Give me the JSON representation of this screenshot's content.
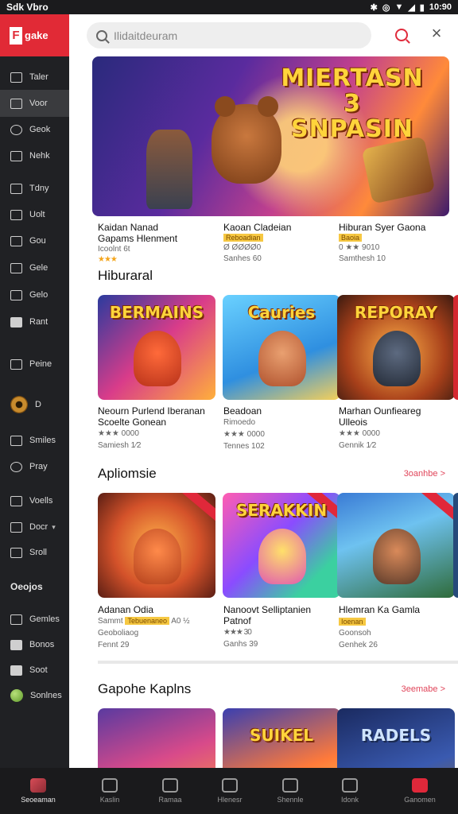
{
  "status_bar": {
    "left": "Sdk Vbro",
    "time": "10:90"
  },
  "sidebar": {
    "logo": "gake",
    "items": [
      {
        "label": "Taler",
        "icon": "tv-icon"
      },
      {
        "label": "Voor",
        "icon": "monitor-icon"
      },
      {
        "label": "Geok",
        "icon": "heart-icon"
      },
      {
        "label": "Nehk",
        "icon": "bookmark-icon"
      },
      {
        "label": "Tdny",
        "icon": "pen-icon"
      },
      {
        "label": "Uolt",
        "icon": "upload-icon"
      },
      {
        "label": "Gou",
        "icon": "home-icon"
      },
      {
        "label": "Gele",
        "icon": "grid-icon"
      },
      {
        "label": "Gelo",
        "icon": "folder-icon"
      },
      {
        "label": "Rant",
        "icon": "thumb-icon"
      },
      {
        "label": "Peine",
        "icon": "gallery-icon"
      },
      {
        "label": "D",
        "icon": "disc-icon"
      },
      {
        "label": "Smiles",
        "icon": "image-icon"
      },
      {
        "label": "Pray",
        "icon": "refresh-icon"
      },
      {
        "label": "Voells",
        "icon": "v-icon"
      },
      {
        "label": "Docr",
        "icon": "doc-icon"
      },
      {
        "label": "Sroll",
        "icon": "scroll-icon"
      },
      {
        "label": "Oeojos",
        "icon": ""
      },
      {
        "label": "Gemles",
        "icon": "share-icon"
      },
      {
        "label": "Bonos",
        "icon": "mail-icon"
      },
      {
        "label": "Soot",
        "icon": "check-icon"
      },
      {
        "label": "Sonlnes",
        "icon": "ball-icon"
      }
    ]
  },
  "search": {
    "placeholder": "Ilidaitdeuram"
  },
  "hero": {
    "title_line1": "MIERTASN 3",
    "title_line2": "SNPASIN",
    "games": [
      {
        "name": "Kaidan Nanad",
        "sub": "Gapams Hlenment",
        "meta": "Icoolnt 6t",
        "stars": "★★★"
      },
      {
        "name": "Kaoan Cladeian",
        "tag": "Reboadian",
        "meta": "Ø ØØØØ0",
        "sub2": "Sanhes 60"
      },
      {
        "name": "Hiburan Syer Gaona",
        "tag": "Baoia",
        "stars": "★★★",
        "meta": "0 ★★ 9010",
        "sub2": "Samthesh 10"
      }
    ]
  },
  "sections": [
    {
      "title": "Hiburaral",
      "cards": [
        {
          "title": "BERMAINS",
          "name": "Neourn Purlend Iberanan",
          "sub": "Scoelte Gonean",
          "meta": "★★★ 0000",
          "meta2": "Samiesh 1⁄2"
        },
        {
          "title": "Cauries",
          "name": "Beadoan",
          "sub": "Rimoedo",
          "meta": "★★★ 0000",
          "meta2": "Tennes 102"
        },
        {
          "title": "REPORAY",
          "name": "Marhan Ounfieareg",
          "sub": "Ulleois",
          "meta": "★★★ 0000",
          "meta2": "Gennik 1⁄2"
        }
      ]
    },
    {
      "title": "Apliomsie",
      "see_more": "3oanhbe >",
      "cards": [
        {
          "title": "",
          "name": "Adanan Odia",
          "sub": "Sammt",
          "tag": "Tebuenaneo",
          "extra": "A0 ½",
          "meta": "Geoboliaog",
          "meta2": "Fennt 29"
        },
        {
          "title": "SERAKKIN",
          "name": "Nanoovt Selliptanien",
          "sub": "Patnof",
          "meta": "★★★ 30",
          "meta2": "Ganhs 39"
        },
        {
          "title": "",
          "name": "Hlemran Ka Gamla",
          "tag": "Ioenan",
          "meta": "Goonsoh",
          "meta2": "Genhek 26"
        }
      ]
    },
    {
      "title": "Gapohe Kaplns",
      "see_more": "3eemabe >",
      "cards": [
        {
          "title": ""
        },
        {
          "title": "SUIKEL"
        },
        {
          "title": "RADELS"
        }
      ]
    }
  ],
  "bottom_nav": [
    {
      "label": "Seoeaman",
      "icon": "home-icon"
    },
    {
      "label": "Kaslin",
      "icon": "arrow-icon"
    },
    {
      "label": "Ramaa",
      "icon": "person-icon"
    },
    {
      "label": "Hlenesr",
      "icon": "house-icon"
    },
    {
      "label": "Shennle",
      "icon": "gamepad-icon"
    },
    {
      "label": "Idonk",
      "icon": "mask-icon"
    },
    {
      "label": "Ganomen",
      "icon": "square-icon"
    }
  ],
  "colors": {
    "accent": "#e12a36",
    "sidebar": "#202124",
    "star": "#f4a51c"
  }
}
